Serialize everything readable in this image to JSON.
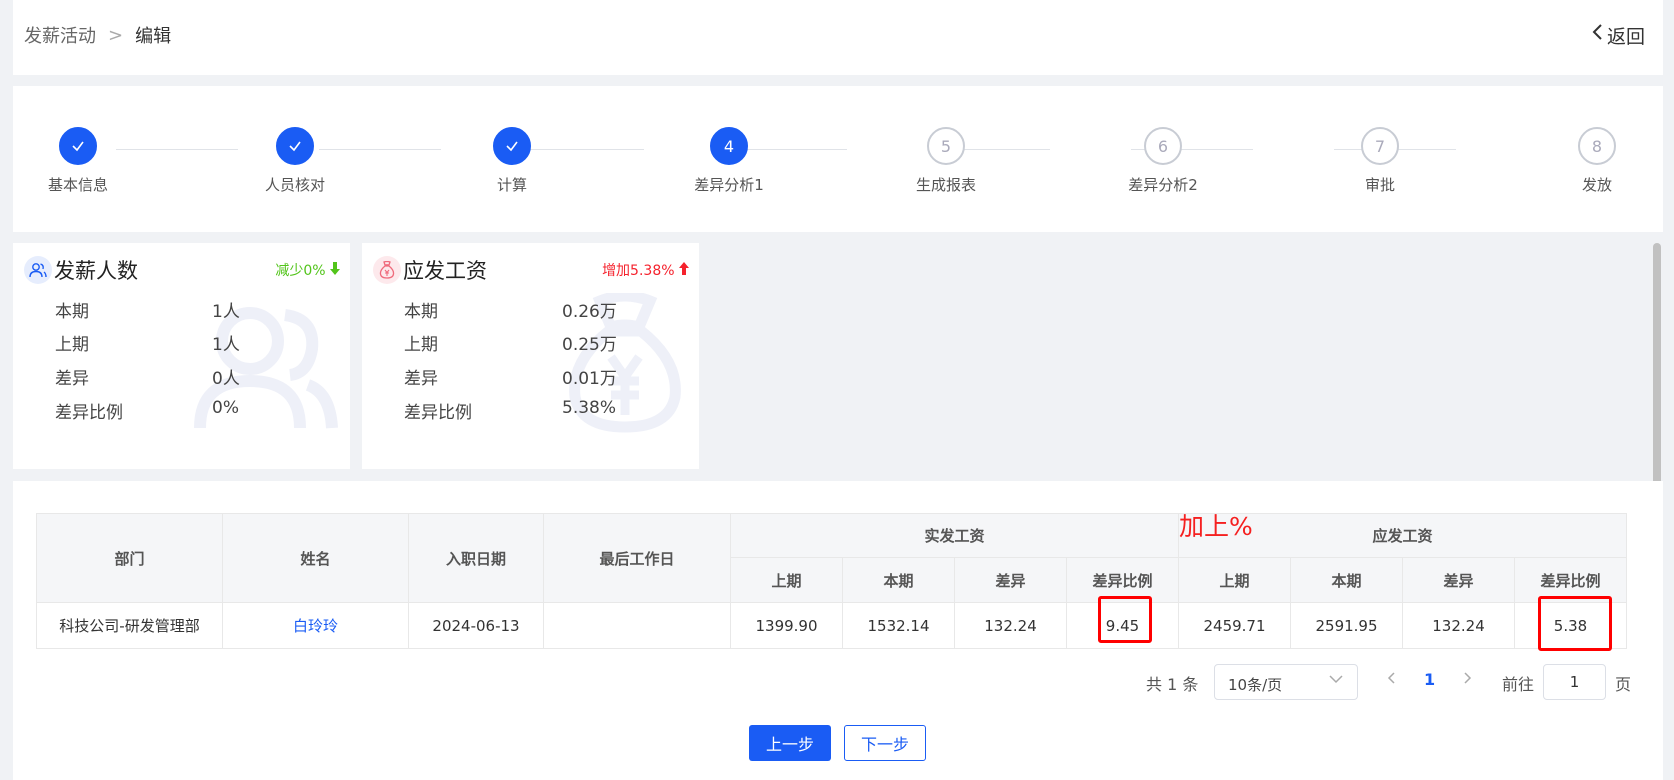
{
  "header": {
    "breadcrumb": [
      "发薪活动",
      "编辑"
    ],
    "separator": ">",
    "back_label": "返回"
  },
  "steps": [
    {
      "num": "1",
      "label": "基本信息",
      "state": "done"
    },
    {
      "num": "2",
      "label": "人员核对",
      "state": "done"
    },
    {
      "num": "3",
      "label": "计算",
      "state": "done"
    },
    {
      "num": "4",
      "label": "差异分析1",
      "state": "active"
    },
    {
      "num": "5",
      "label": "生成报表",
      "state": "todo"
    },
    {
      "num": "6",
      "label": "差异分析2",
      "state": "todo"
    },
    {
      "num": "7",
      "label": "审批",
      "state": "todo"
    },
    {
      "num": "8",
      "label": "发放",
      "state": "todo"
    }
  ],
  "cards": {
    "headcount": {
      "title": "发薪人数",
      "trend": "减少0%",
      "rows": [
        {
          "label": "本期",
          "value": "1人"
        },
        {
          "label": "上期",
          "value": "1人"
        },
        {
          "label": "差异",
          "value": "0人"
        },
        {
          "label": "差异比例",
          "value": "0%"
        }
      ]
    },
    "salary": {
      "title": "应发工资",
      "trend": "增加5.38%",
      "rows": [
        {
          "label": "本期",
          "value": "0.26万"
        },
        {
          "label": "上期",
          "value": "0.25万"
        },
        {
          "label": "差异",
          "value": "0.01万"
        },
        {
          "label": "差异比例",
          "value": "5.38%"
        }
      ]
    }
  },
  "table": {
    "headers": {
      "dept": "部门",
      "name": "姓名",
      "join_date": "入职日期",
      "last_day": "最后工作日",
      "group1": "实发工资",
      "group2": "应发工资",
      "sub": [
        "上期",
        "本期",
        "差异",
        "差异比例",
        "上期",
        "本期",
        "差异",
        "差异比例"
      ]
    },
    "rows": [
      {
        "dept": "科技公司-研发管理部",
        "name": "白玲玲",
        "join_date": "2024-06-13",
        "last_day": "",
        "cells": [
          "1399.90",
          "1532.14",
          "132.24",
          "9.45",
          "2459.71",
          "2591.95",
          "132.24",
          "5.38"
        ]
      }
    ],
    "annotation": "加上%"
  },
  "pagination": {
    "total": "共 1 条",
    "page_size": "10条/页",
    "current": "1",
    "goto_label": "前往",
    "goto_value": "1",
    "page_unit": "页"
  },
  "buttons": {
    "prev": "上一步",
    "next": "下一步"
  },
  "colors": {
    "primary": "#1a5cf4",
    "up": "#f5222d",
    "down": "#52c41a",
    "annotation": "#f52020"
  }
}
